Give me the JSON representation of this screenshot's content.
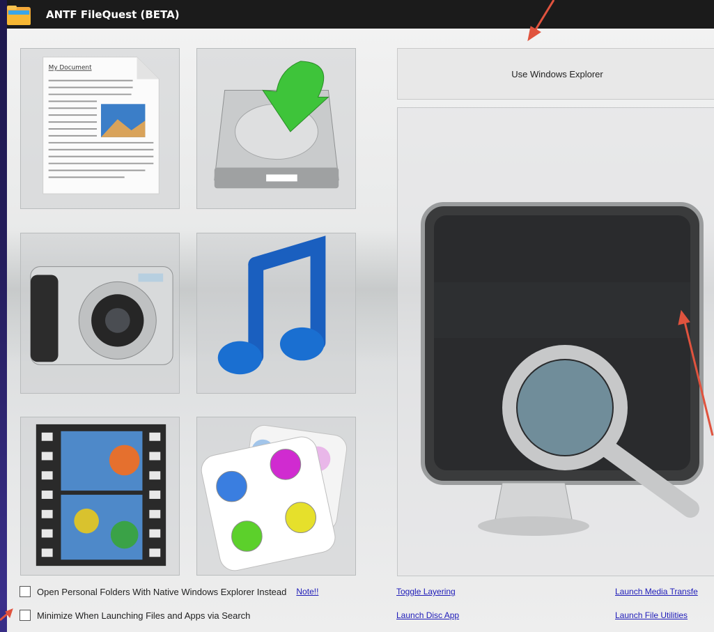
{
  "window": {
    "title": "ANTF FileQuest (BETA)"
  },
  "tiles": [
    {
      "name": "documents-tile",
      "icon": "document-icon",
      "doc_heading": "My Document"
    },
    {
      "name": "downloads-tile",
      "icon": "download-drive-icon"
    },
    {
      "name": "pictures-tile",
      "icon": "camera-icon"
    },
    {
      "name": "music-tile",
      "icon": "music-note-icon"
    },
    {
      "name": "videos-tile",
      "icon": "film-strip-icon"
    },
    {
      "name": "apps-tile",
      "icon": "app-dice-icon"
    }
  ],
  "main": {
    "use_explorer_label": "Use Windows Explorer",
    "search_panel_icon": "monitor-search-icon"
  },
  "options": {
    "native_explorer_label": "Open Personal Folders With Native Windows Explorer Instead",
    "note_link": "Note!!",
    "minimize_label": "Minimize When Launching Files and Apps via Search"
  },
  "links": {
    "toggle_layering": "Toggle Layering",
    "launch_disc_app": "Launch Disc App",
    "launch_media_transfer": "Launch Media Transfe",
    "launch_file_utilities": "Launch File Utilities"
  },
  "colors": {
    "titlebar": "#1b1b1b",
    "link": "#1d1ab8",
    "annotation_arrow": "#e0533e"
  }
}
